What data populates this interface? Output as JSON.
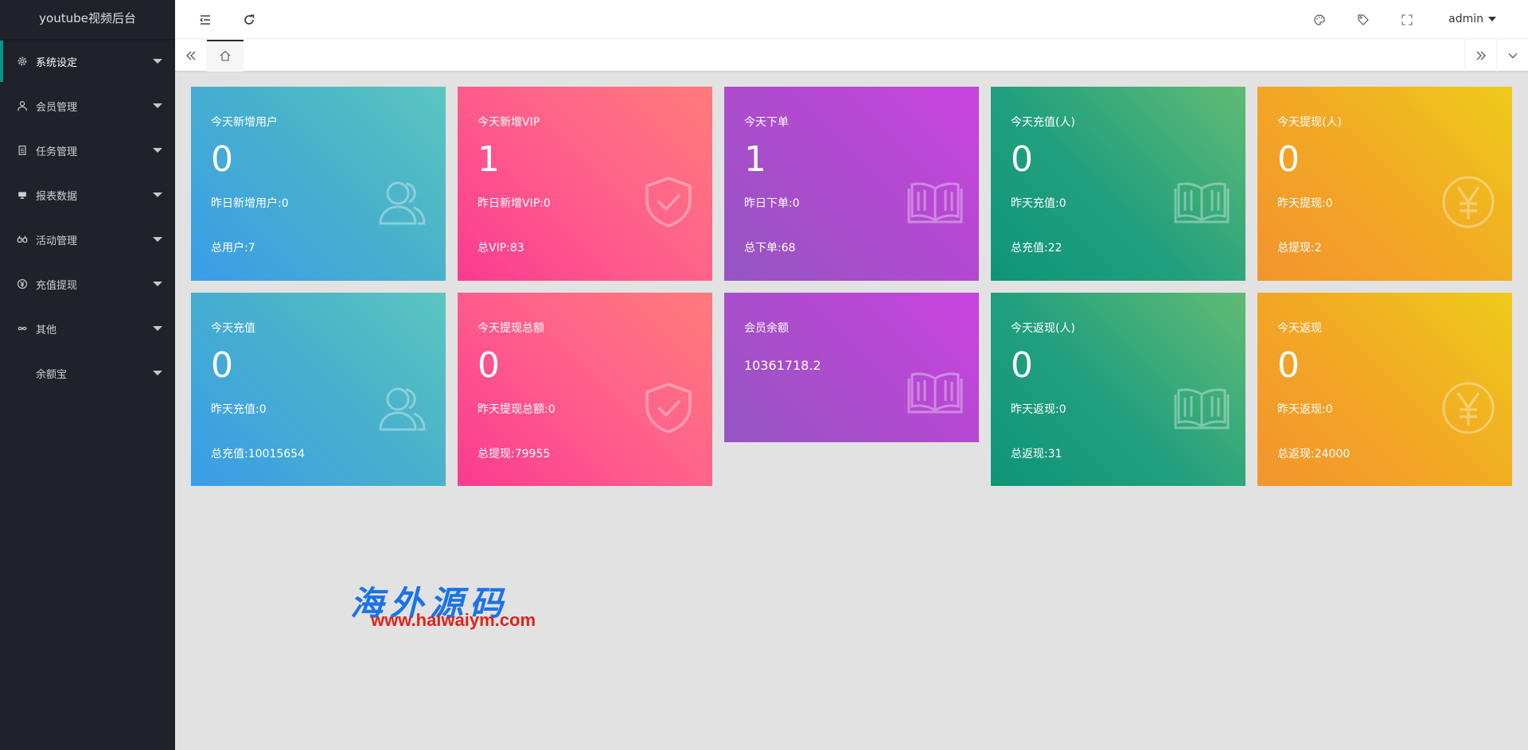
{
  "app": {
    "title": "youtube视频后台"
  },
  "sidebar": {
    "items": [
      {
        "label": "系统设定",
        "icon": "gear-icon"
      },
      {
        "label": "会员管理",
        "icon": "user-icon"
      },
      {
        "label": "任务管理",
        "icon": "document-icon"
      },
      {
        "label": "报表数据",
        "icon": "monitor-icon"
      },
      {
        "label": "活动管理",
        "icon": "binoculars-icon"
      },
      {
        "label": "充值提现",
        "icon": "yen-icon"
      },
      {
        "label": "其他",
        "icon": "infinity-icon"
      },
      {
        "label": "余额宝",
        "icon": ""
      }
    ]
  },
  "header": {
    "user": "admin"
  },
  "cards": [
    {
      "title": "今天新增用户",
      "value": "0",
      "line1": "昨日新增用户:0",
      "line2": "总用户:7"
    },
    {
      "title": "今天新增VIP",
      "value": "1",
      "line1": "昨日新增VIP:0",
      "line2": "总VIP:83"
    },
    {
      "title": "今天下单",
      "value": "1",
      "line1": "昨日下单:0",
      "line2": "总下单:68"
    },
    {
      "title": "今天充值(人)",
      "value": "0",
      "line1": "昨天充值:0",
      "line2": "总充值:22"
    },
    {
      "title": "今天提现(人)",
      "value": "0",
      "line1": "昨天提现:0",
      "line2": "总提现:2"
    },
    {
      "title": "今天充值",
      "value": "0",
      "line1": "昨天充值:0",
      "line2": "总充值:10015654"
    },
    {
      "title": "今天提现总额",
      "value": "0",
      "line1": "昨天提现总额:0",
      "line2": "总提现:79955"
    },
    {
      "title": "会员余额",
      "value": "10361718.2"
    },
    {
      "title": "今天返现(人)",
      "value": "0",
      "line1": "昨天返现:0",
      "line2": "总返现:31"
    },
    {
      "title": "今天返现",
      "value": "0",
      "line1": "昨天返现:0",
      "line2": "总返现:24000"
    }
  ],
  "watermark": {
    "cn": "海外源码",
    "url": "www.haiwaiym.com"
  },
  "colors": {
    "accent": "#009688",
    "sidebar": "#20222a"
  }
}
